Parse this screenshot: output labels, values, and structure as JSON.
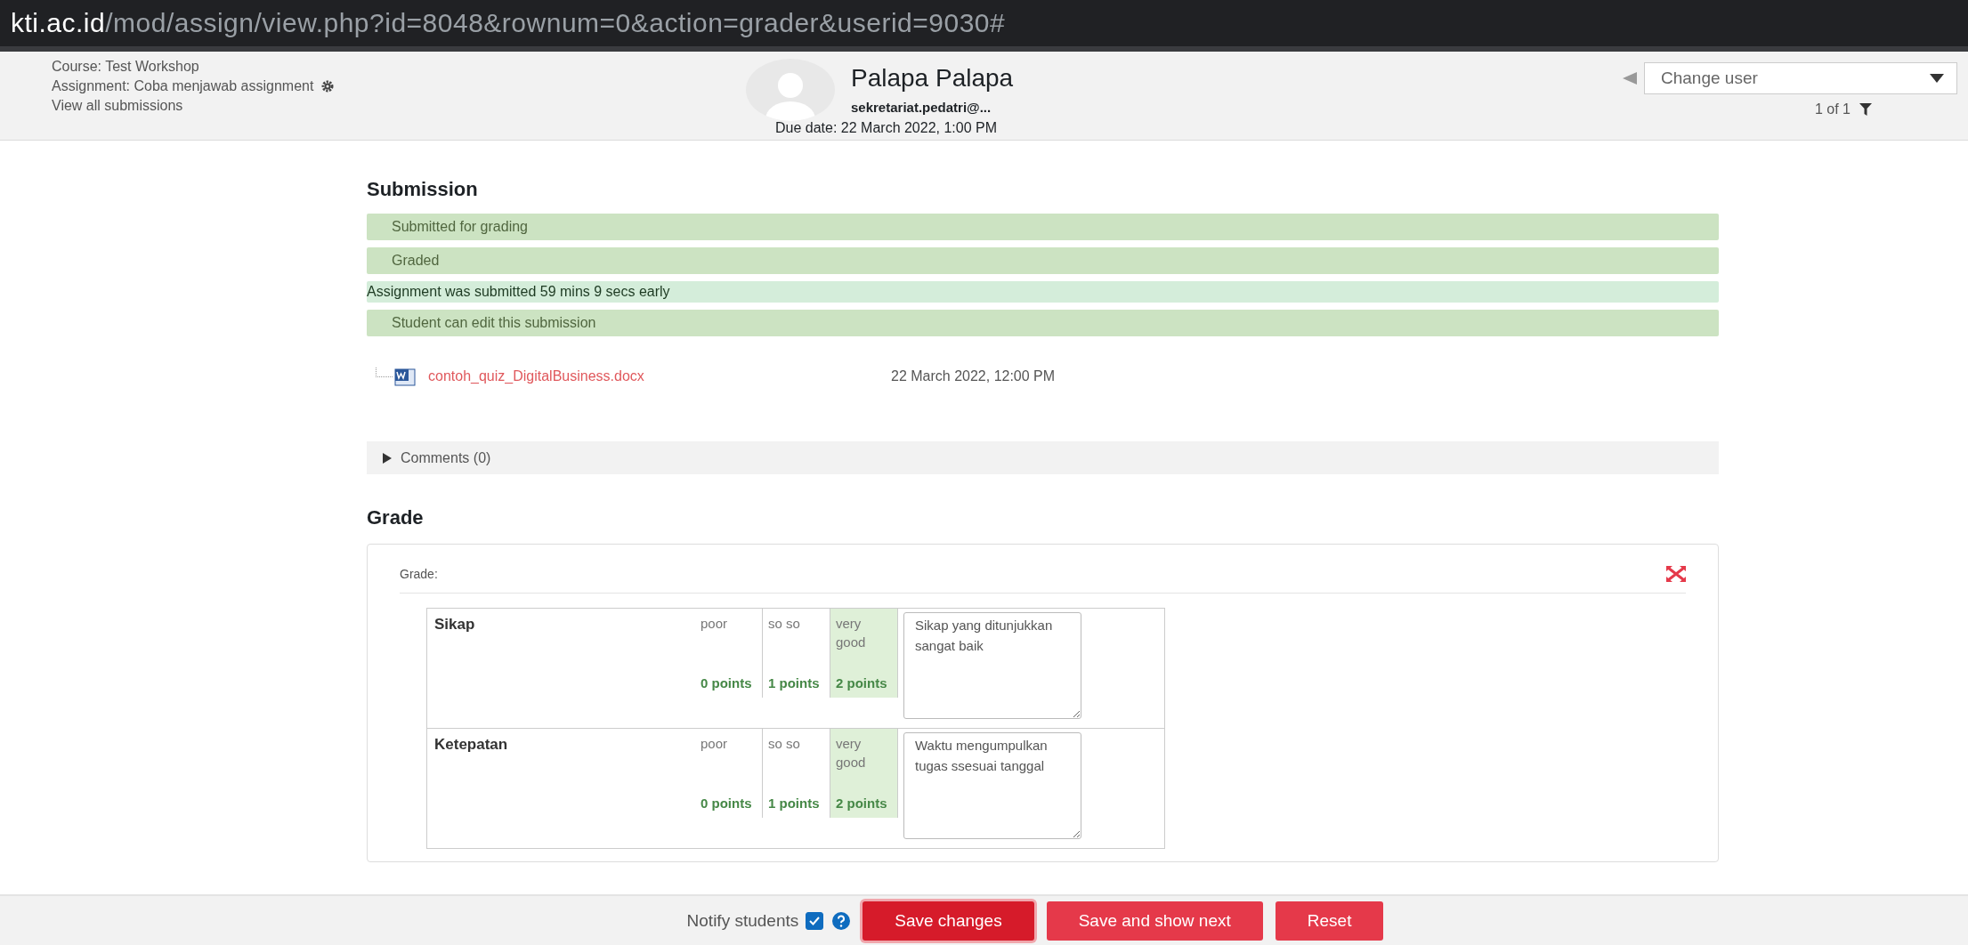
{
  "url": {
    "host": "kti.ac.id",
    "path": "/mod/assign/view.php?id=8048&rownum=0&action=grader&userid=9030#"
  },
  "header": {
    "course": "Course: Test Workshop",
    "assignment": "Assignment: Coba menjawab assignment",
    "view_all": "View all submissions",
    "user_name": "Palapa Palapa",
    "email": "sekretariat.pedatri@...",
    "due_date": "Due date: 22 March 2022, 1:00 PM",
    "change_user": {
      "placeholder": "Change user"
    },
    "pager": "1 of 1"
  },
  "submission": {
    "title": "Submission",
    "statuses": [
      {
        "kind": "status",
        "text": "Submitted for grading"
      },
      {
        "kind": "status",
        "text": "Graded"
      },
      {
        "kind": "note",
        "text": "Assignment was submitted 59 mins 9 secs early"
      },
      {
        "kind": "status",
        "text": "Student can edit this submission"
      }
    ],
    "file": {
      "name": "contoh_quiz_DigitalBusiness.docx",
      "date": "22 March 2022, 12:00 PM"
    },
    "comments": {
      "label": "Comments (0)",
      "expanded": false
    }
  },
  "grade": {
    "title": "Grade",
    "label": "Grade:",
    "criteria": [
      {
        "name": "Sikap",
        "levels": [
          {
            "definition": "poor",
            "points": "0 points",
            "selected": false
          },
          {
            "definition": "so so",
            "points": "1 points",
            "selected": false
          },
          {
            "definition": "very good",
            "points": "2 points",
            "selected": true
          }
        ],
        "remark": "Sikap yang ditunjukkan sangat baik"
      },
      {
        "name": "Ketepatan",
        "levels": [
          {
            "definition": "poor",
            "points": "0 points",
            "selected": false
          },
          {
            "definition": "so so",
            "points": "1 points",
            "selected": false
          },
          {
            "definition": "very good",
            "points": "2 points",
            "selected": true
          }
        ],
        "remark": "Waktu mengumpulkan tugas ssesuai tanggal"
      }
    ]
  },
  "footer": {
    "notify": {
      "label": "Notify students",
      "checked": true
    },
    "buttons": [
      {
        "label": "Save changes",
        "focused": true
      },
      {
        "label": "Save and show next",
        "focused": false
      },
      {
        "label": "Reset",
        "focused": false
      }
    ]
  }
}
